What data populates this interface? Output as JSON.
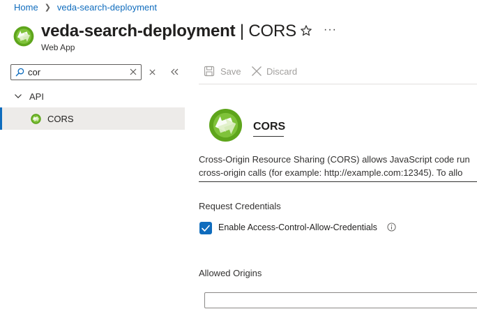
{
  "breadcrumb": [
    {
      "label": "Home"
    },
    {
      "label": "veda-search-deployment"
    }
  ],
  "header": {
    "resource_name": "veda-search-deployment",
    "separator_page": " | CORS",
    "subtitle": "Web App",
    "more_label": "···"
  },
  "sidebar": {
    "search": {
      "value": "cor",
      "placeholder": ""
    },
    "groups": [
      {
        "label": "API",
        "items": [
          {
            "label": "CORS",
            "selected": true
          }
        ]
      }
    ]
  },
  "toolbar": {
    "save_label": "Save",
    "discard_label": "Discard"
  },
  "main": {
    "heading": "CORS",
    "description_lines": [
      "Cross-Origin Resource Sharing (CORS) allows JavaScript code run",
      "cross-origin calls (for example: http://example.com:12345). To allo"
    ],
    "request_credentials_label": "Request Credentials",
    "credentials_checkbox": {
      "label": "Enable Access-Control-Allow-Credentials",
      "checked": true
    },
    "allowed_origins_label": "Allowed Origins",
    "origin_input_value": ""
  },
  "colors": {
    "accent": "#0f6cbd",
    "selected_bg": "#edebe9",
    "disabled_text": "#a19f9d",
    "logo_green": "#5ea51c"
  },
  "icons": [
    "web-app-icon",
    "star-icon",
    "more-icon",
    "search-icon",
    "clear-icon",
    "collapse-filter-icon",
    "collapse-sidebar-icon",
    "chevron-down-icon",
    "save-icon",
    "discard-icon",
    "checkbox-checked-icon",
    "info-icon"
  ]
}
